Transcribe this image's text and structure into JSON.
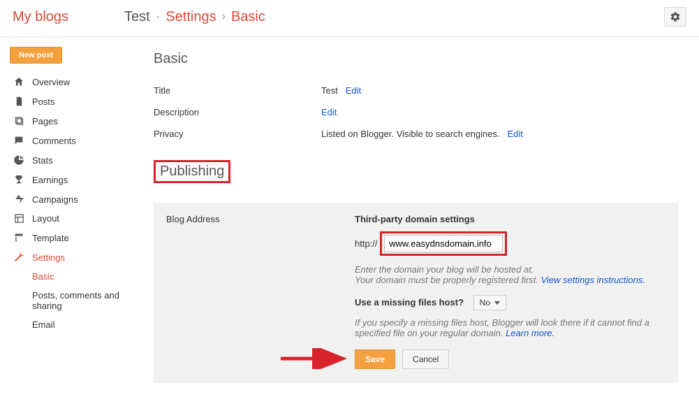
{
  "header": {
    "brand": "My blogs",
    "breadcrumb": {
      "blog": "Test",
      "section": "Settings",
      "page": "Basic"
    }
  },
  "sidebar": {
    "new_post": "New post",
    "items": [
      {
        "label": "Overview"
      },
      {
        "label": "Posts"
      },
      {
        "label": "Pages"
      },
      {
        "label": "Comments"
      },
      {
        "label": "Stats"
      },
      {
        "label": "Earnings"
      },
      {
        "label": "Campaigns"
      },
      {
        "label": "Layout"
      },
      {
        "label": "Template"
      },
      {
        "label": "Settings"
      }
    ],
    "settings_sub": [
      {
        "label": "Basic"
      },
      {
        "label": "Posts, comments and sharing"
      },
      {
        "label": "Email"
      }
    ]
  },
  "basic": {
    "heading": "Basic",
    "title_label": "Title",
    "title_value": "Test",
    "edit": "Edit",
    "description_label": "Description",
    "privacy_label": "Privacy",
    "privacy_value": "Listed on Blogger. Visible to search engines."
  },
  "publishing": {
    "heading": "Publishing",
    "blog_address_label": "Blog Address",
    "third_party_heading": "Third-party domain settings",
    "http_prefix": "http://",
    "domain_value": "www.easydnsdomain.info",
    "hint_line1": "Enter the domain your blog will be hosted at.",
    "hint_line2_pre": "Your domain must be properly registered first. ",
    "hint_link1": "View settings instructions.",
    "missing_files_label": "Use a missing files host?",
    "missing_files_value": "No",
    "missing_hint_pre": "If you specify a missing files host, Blogger will look there if it cannot find a specified file on your regular domain. ",
    "missing_hint_link": "Learn more.",
    "save": "Save",
    "cancel": "Cancel"
  }
}
